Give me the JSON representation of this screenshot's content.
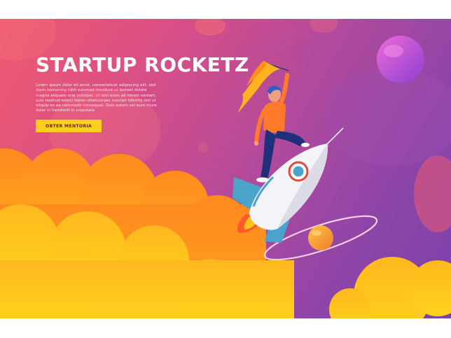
{
  "hero": {
    "title": "STARTUP ROCKETZ",
    "body": "Lorem ipsum dolor sit amet, consectetuer adipiscing elit, sed diam nonummy nibh euismod tincidunt ut laoreet dolore magna aliquam erat volutpat. Ut wisi enim ad minim veniam, quis nostrud exerci tation ullamcorper suscipit lobortis nisl ut aliquip ex ea commodo consequat. Duis autem vel eum iriure dolor in hendrerit in vulputate",
    "cta_label": "OBTER MENTORIA"
  },
  "colors": {
    "background_top": "#ef5a6e",
    "background_bottom": "#7a42ac",
    "cloud_orange": "#ff8c1a",
    "cloud_yellow": "#ffc21a",
    "cta": "#ffcf1f",
    "rocket_body": "#f2f2f7",
    "rocket_fin": "#4aa3c9",
    "planet_purple": "#c94fe3",
    "planet_orange": "#f7a43a"
  },
  "illustration": {
    "subject": "person-with-flag-riding-rocket",
    "icons": [
      "rocket-icon",
      "flag-icon",
      "planet-icon",
      "ringed-planet-icon"
    ]
  }
}
